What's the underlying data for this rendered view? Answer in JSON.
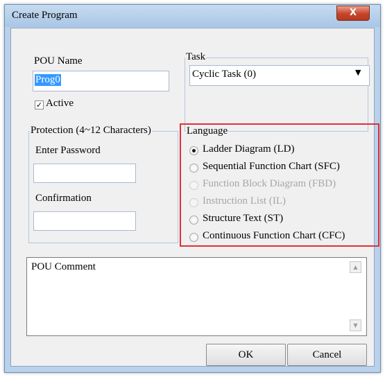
{
  "dialog": {
    "title": "Create Program",
    "close_glyph": "X"
  },
  "pou": {
    "name_label": "POU Name",
    "name_value": "Prog0",
    "active_label": "Active",
    "active_checked": true
  },
  "task": {
    "legend": "Task",
    "selected": "Cyclic Task (0)"
  },
  "protection": {
    "legend": "Protection (4~12 Characters)",
    "password_label": "Enter Password",
    "password_value": "",
    "confirmation_label": "Confirmation",
    "confirmation_value": ""
  },
  "language": {
    "legend": "Language",
    "options": [
      {
        "label": "Ladder Diagram (LD)",
        "checked": true,
        "enabled": true
      },
      {
        "label": "Sequential Function Chart (SFC)",
        "checked": false,
        "enabled": true
      },
      {
        "label": "Function Block Diagram (FBD)",
        "checked": false,
        "enabled": false
      },
      {
        "label": "Instruction List (IL)",
        "checked": false,
        "enabled": false
      },
      {
        "label": "Structure Text (ST)",
        "checked": false,
        "enabled": true
      },
      {
        "label": "Continuous Function Chart (CFC)",
        "checked": false,
        "enabled": true
      }
    ],
    "highlight_color": "#e0303a"
  },
  "comment": {
    "label": "POU Comment",
    "value": ""
  },
  "buttons": {
    "ok": "OK",
    "cancel": "Cancel"
  },
  "icons": {
    "combo_arrow": "dropdown-arrow",
    "scroll_up": "scroll-up-arrow",
    "scroll_down": "scroll-down-arrow"
  }
}
